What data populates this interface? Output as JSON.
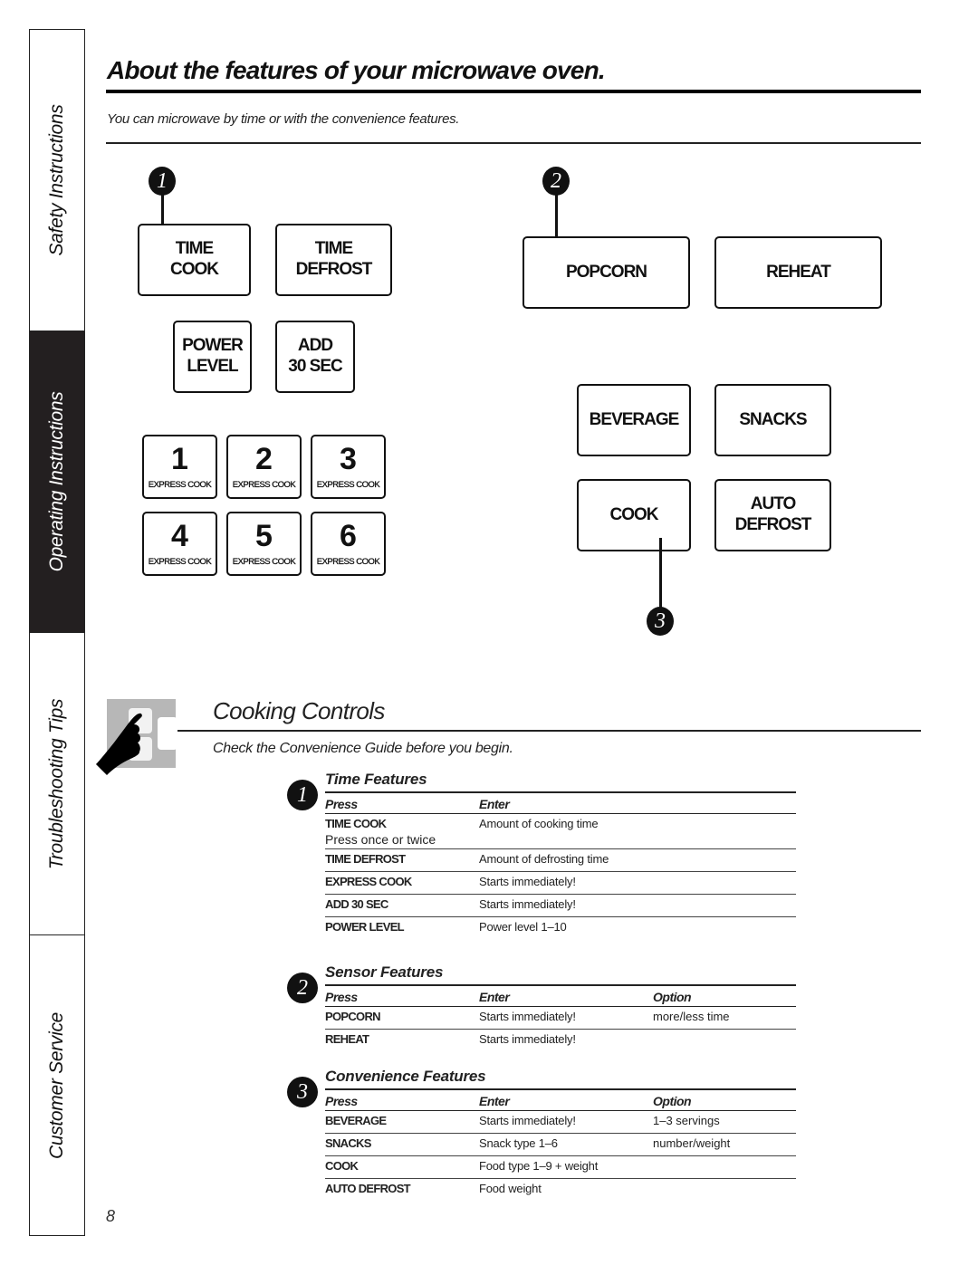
{
  "sidebar": {
    "tabs": [
      {
        "label": "Safety Instructions",
        "active": false
      },
      {
        "label": "Operating Instructions",
        "active": true
      },
      {
        "label": "Troubleshooting Tips",
        "active": false
      },
      {
        "label": "Customer Service",
        "active": false
      }
    ]
  },
  "header": {
    "title": "About the features of your microwave oven.",
    "subtitle": "You can microwave by time or with the convenience features."
  },
  "callouts": [
    "1",
    "2",
    "3"
  ],
  "keypad": {
    "time_cook": [
      "TIME",
      "COOK"
    ],
    "time_defrost": [
      "TIME",
      "DEFROST"
    ],
    "power_level": [
      "POWER",
      "LEVEL"
    ],
    "add_30_sec": [
      "ADD",
      "30 SEC"
    ],
    "number_keys": [
      {
        "number": "1",
        "sub": "EXPRESS COOK"
      },
      {
        "number": "2",
        "sub": "EXPRESS COOK"
      },
      {
        "number": "3",
        "sub": "EXPRESS COOK"
      },
      {
        "number": "4",
        "sub": "EXPRESS COOK"
      },
      {
        "number": "5",
        "sub": "EXPRESS COOK"
      },
      {
        "number": "6",
        "sub": "EXPRESS COOK"
      }
    ],
    "popcorn": "POPCORN",
    "reheat": "REHEAT",
    "beverage": "BEVERAGE",
    "snacks": "SNACKS",
    "cook": "COOK",
    "auto_defrost": [
      "AUTO",
      "DEFROST"
    ]
  },
  "cooking_controls": {
    "icon": "hand-pressing-keypad-icon",
    "title": "Cooking Controls",
    "subtitle": "Check the Convenience Guide before you begin.",
    "sections": [
      {
        "number": "1",
        "heading": "Time Features",
        "columns": [
          "Press",
          "Enter"
        ],
        "rows": [
          {
            "press": "TIME COOK",
            "note": "Press once or twice",
            "enter": "Amount of cooking time"
          },
          {
            "press": "TIME DEFROST",
            "enter": "Amount of defrosting time"
          },
          {
            "press": "EXPRESS COOK",
            "enter": "Starts immediately!"
          },
          {
            "press": "ADD 30 SEC",
            "enter": "Starts immediately!"
          },
          {
            "press": "POWER LEVEL",
            "enter": "Power level 1–10"
          }
        ]
      },
      {
        "number": "2",
        "heading": "Sensor Features",
        "columns": [
          "Press",
          "Enter",
          "Option"
        ],
        "rows": [
          {
            "press": "POPCORN",
            "enter": "Starts immediately!",
            "option": "more/less time"
          },
          {
            "press": "REHEAT",
            "enter": "Starts immediately!",
            "option": ""
          }
        ]
      },
      {
        "number": "3",
        "heading": "Convenience Features",
        "columns": [
          "Press",
          "Enter",
          "Option"
        ],
        "rows": [
          {
            "press": "BEVERAGE",
            "enter": "Starts immediately!",
            "option": "1–3 servings"
          },
          {
            "press": "SNACKS",
            "enter": "Snack type 1–6",
            "option": "number/weight"
          },
          {
            "press": "COOK",
            "enter": "Food type 1–9 + weight",
            "option": ""
          },
          {
            "press": "AUTO DEFROST",
            "enter": "Food weight",
            "option": ""
          }
        ]
      }
    ]
  },
  "page_number": "8"
}
